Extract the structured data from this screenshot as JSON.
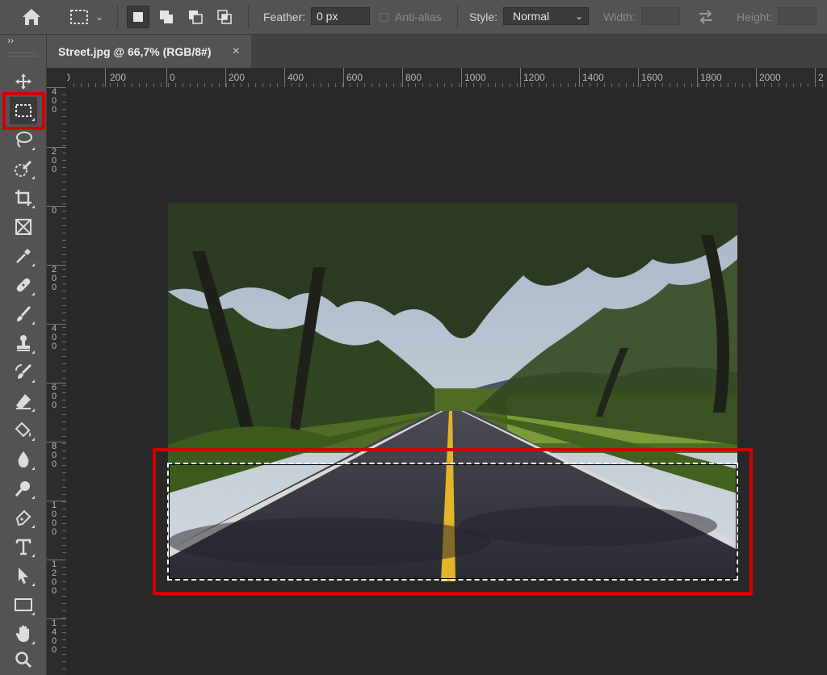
{
  "options_bar": {
    "feather_label": "Feather:",
    "feather_value": "0 px",
    "anti_alias_label": "Anti-alias",
    "style_label": "Style:",
    "style_value": "Normal",
    "width_label": "Width:",
    "height_label": "Height:"
  },
  "document_tab": {
    "title": "Street.jpg @ 66,7% (RGB/8#)",
    "close_glyph": "×"
  },
  "toolbar": {
    "collapse_glyph": "››",
    "tools": [
      {
        "name": "move-tool",
        "icon": "move-icon",
        "active": false
      },
      {
        "name": "rectangular-marquee-tool",
        "icon": "rectangle-marquee-icon",
        "active": true
      },
      {
        "name": "lasso-tool",
        "icon": "lasso-icon",
        "active": false
      },
      {
        "name": "quick-selection-tool",
        "icon": "quick-selection-icon",
        "active": false
      },
      {
        "name": "crop-tool",
        "icon": "crop-icon",
        "active": false
      },
      {
        "name": "frame-tool",
        "icon": "frame-icon",
        "active": false
      },
      {
        "name": "eyedropper-tool",
        "icon": "eyedropper-icon",
        "active": false
      },
      {
        "name": "healing-brush-tool",
        "icon": "bandage-icon",
        "active": false
      },
      {
        "name": "brush-tool",
        "icon": "brush-icon",
        "active": false
      },
      {
        "name": "clone-stamp-tool",
        "icon": "stamp-icon",
        "active": false
      },
      {
        "name": "history-brush-tool",
        "icon": "history-brush-icon",
        "active": false
      },
      {
        "name": "eraser-tool",
        "icon": "eraser-icon",
        "active": false
      },
      {
        "name": "paint-bucket-tool",
        "icon": "paint-bucket-icon",
        "active": false
      },
      {
        "name": "blur-tool",
        "icon": "drop-icon",
        "active": false
      },
      {
        "name": "dodge-tool",
        "icon": "dodge-icon",
        "active": false
      },
      {
        "name": "pen-tool",
        "icon": "pen-icon",
        "active": false
      },
      {
        "name": "type-tool",
        "icon": "type-icon",
        "active": false
      },
      {
        "name": "path-selection-tool",
        "icon": "arrow-icon",
        "active": false
      },
      {
        "name": "rectangle-tool",
        "icon": "rectangle-icon",
        "active": false
      },
      {
        "name": "hand-tool",
        "icon": "hand-icon",
        "active": false
      },
      {
        "name": "zoom-tool",
        "icon": "magnifier-icon",
        "active": false
      }
    ]
  },
  "rulers": {
    "horizontal_labels": [
      "0",
      "200",
      "0",
      "200",
      "400",
      "600",
      "800",
      "1000",
      "1200",
      "1400",
      "1600",
      "1800",
      "2000",
      "2"
    ],
    "vertical_labels": [
      "400",
      "200",
      "0",
      "200",
      "400",
      "600",
      "800",
      "1000",
      "1200",
      "1400"
    ]
  },
  "colors": {
    "accent_highlight": "#d10000",
    "center_line": "#e0b52a",
    "canvas_bg": "#282828",
    "ui_bg": "#535353"
  }
}
